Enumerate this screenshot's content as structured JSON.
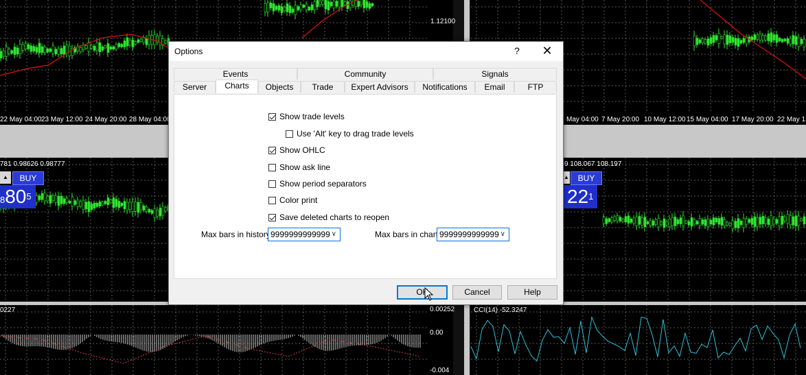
{
  "background": {
    "top_axis_left": [
      "22 May 04:00",
      "23 May 12:00",
      "24 May 20:00",
      "28 May 04:00"
    ],
    "top_axis_right": [
      "May 04:00",
      "7 May 20:00",
      "10 May 12:00",
      "15 May 04:00",
      "17 May 20:00",
      "22 May 1"
    ],
    "price_labels": [
      "1.12100",
      "0.00252",
      "0.00",
      "-0.004"
    ],
    "left_quote": "781 0.98626 0.98777",
    "right_quote": "9 108.067 108.197",
    "left_widget": {
      "buy_label": "BUY",
      "price_small": "8",
      "price_big": "80",
      "price_sup": "5"
    },
    "right_widget": {
      "buy_label": "BUY",
      "price_big": "22",
      "price_sup": "1"
    },
    "indicator_left": "0227",
    "indicator_right": "CCI(14) -52.3247",
    "colors": {
      "candle": "#2ee52e",
      "ma": "#e01010",
      "grid": "#5a5a5a"
    }
  },
  "dialog": {
    "title": "Options",
    "help_glyph": "?",
    "close_glyph": "✕",
    "tabs_top": [
      "Events",
      "Community",
      "Signals"
    ],
    "tabs_bottom": [
      "Server",
      "Charts",
      "Objects",
      "Trade",
      "Expert Advisors",
      "Notifications",
      "Email",
      "FTP"
    ],
    "active_tab": "Charts",
    "checkboxes": [
      {
        "label": "Show trade levels",
        "checked": true
      },
      {
        "label": "Use 'Alt' key to drag trade levels",
        "checked": false
      },
      {
        "label": "Show OHLC",
        "checked": true
      },
      {
        "label": "Show ask line",
        "checked": false
      },
      {
        "label": "Show period separators",
        "checked": false
      },
      {
        "label": "Color print",
        "checked": false
      },
      {
        "label": "Save deleted charts to reopen",
        "checked": true
      }
    ],
    "max_bars_history": {
      "label": "Max bars in history:",
      "value": "9999999999999"
    },
    "max_bars_chart": {
      "label": "Max bars in chart:",
      "value": "9999999999999"
    },
    "buttons": {
      "ok": "OK",
      "cancel": "Cancel",
      "help": "Help"
    }
  }
}
